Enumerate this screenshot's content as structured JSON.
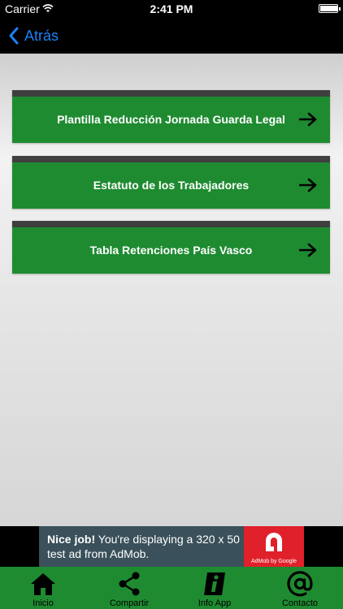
{
  "status_bar": {
    "carrier": "Carrier",
    "time": "2:41 PM",
    "battery_level": 0.95
  },
  "nav": {
    "back_label": "Atrás"
  },
  "menu": {
    "items": [
      {
        "label": "Plantilla Reducción Jornada Guarda Legal",
        "icon": "arrow-right-icon"
      },
      {
        "label": "Estatuto de los Trabajadores",
        "icon": "arrow-right-icon"
      },
      {
        "label": "Tabla Retenciones País Vasco",
        "icon": "arrow-right-icon"
      }
    ]
  },
  "ad": {
    "headline": "Nice job!",
    "message": "You're displaying a 320 x 50 test ad from AdMob.",
    "badge": "AdMob by Google"
  },
  "tabs": [
    {
      "label": "Inicio",
      "icon": "home-icon"
    },
    {
      "label": "Compartir",
      "icon": "share-icon"
    },
    {
      "label": "Info App",
      "icon": "info-icon"
    },
    {
      "label": "Contacto",
      "icon": "at-sign-icon"
    }
  ],
  "colors": {
    "accent": "#1a82f7",
    "menu_green": "#1f8b31",
    "menu_strip": "#3f3f3f",
    "ad_red": "#e0202a"
  }
}
